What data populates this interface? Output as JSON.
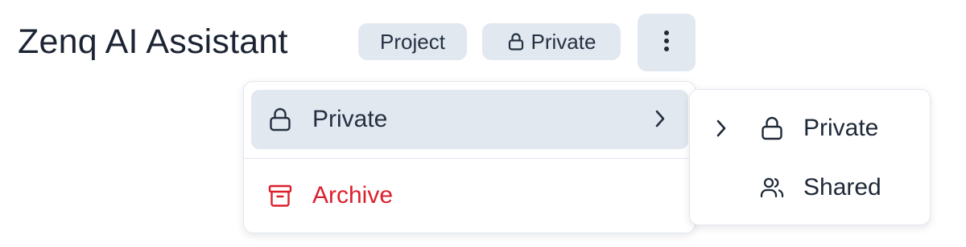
{
  "header": {
    "title": "Zenq AI Assistant",
    "project_badge": "Project",
    "visibility_badge": "Private",
    "more_button_icon": "vertical-ellipsis-icon"
  },
  "menu": {
    "items": [
      {
        "label": "Private",
        "icon": "lock-icon",
        "trailing_icon": "chevron-right-icon",
        "highlighted": true
      },
      {
        "label": "Archive",
        "icon": "archive-icon",
        "color": "#dc1f2d"
      }
    ]
  },
  "submenu": {
    "items": [
      {
        "label": "Private",
        "icon": "lock-icon",
        "selected": true
      },
      {
        "label": "Shared",
        "icon": "users-icon",
        "selected": false
      }
    ]
  },
  "colors": {
    "badge_bg": "#e2e8f0",
    "text": "#1f2937",
    "danger": "#dc1f2d"
  }
}
